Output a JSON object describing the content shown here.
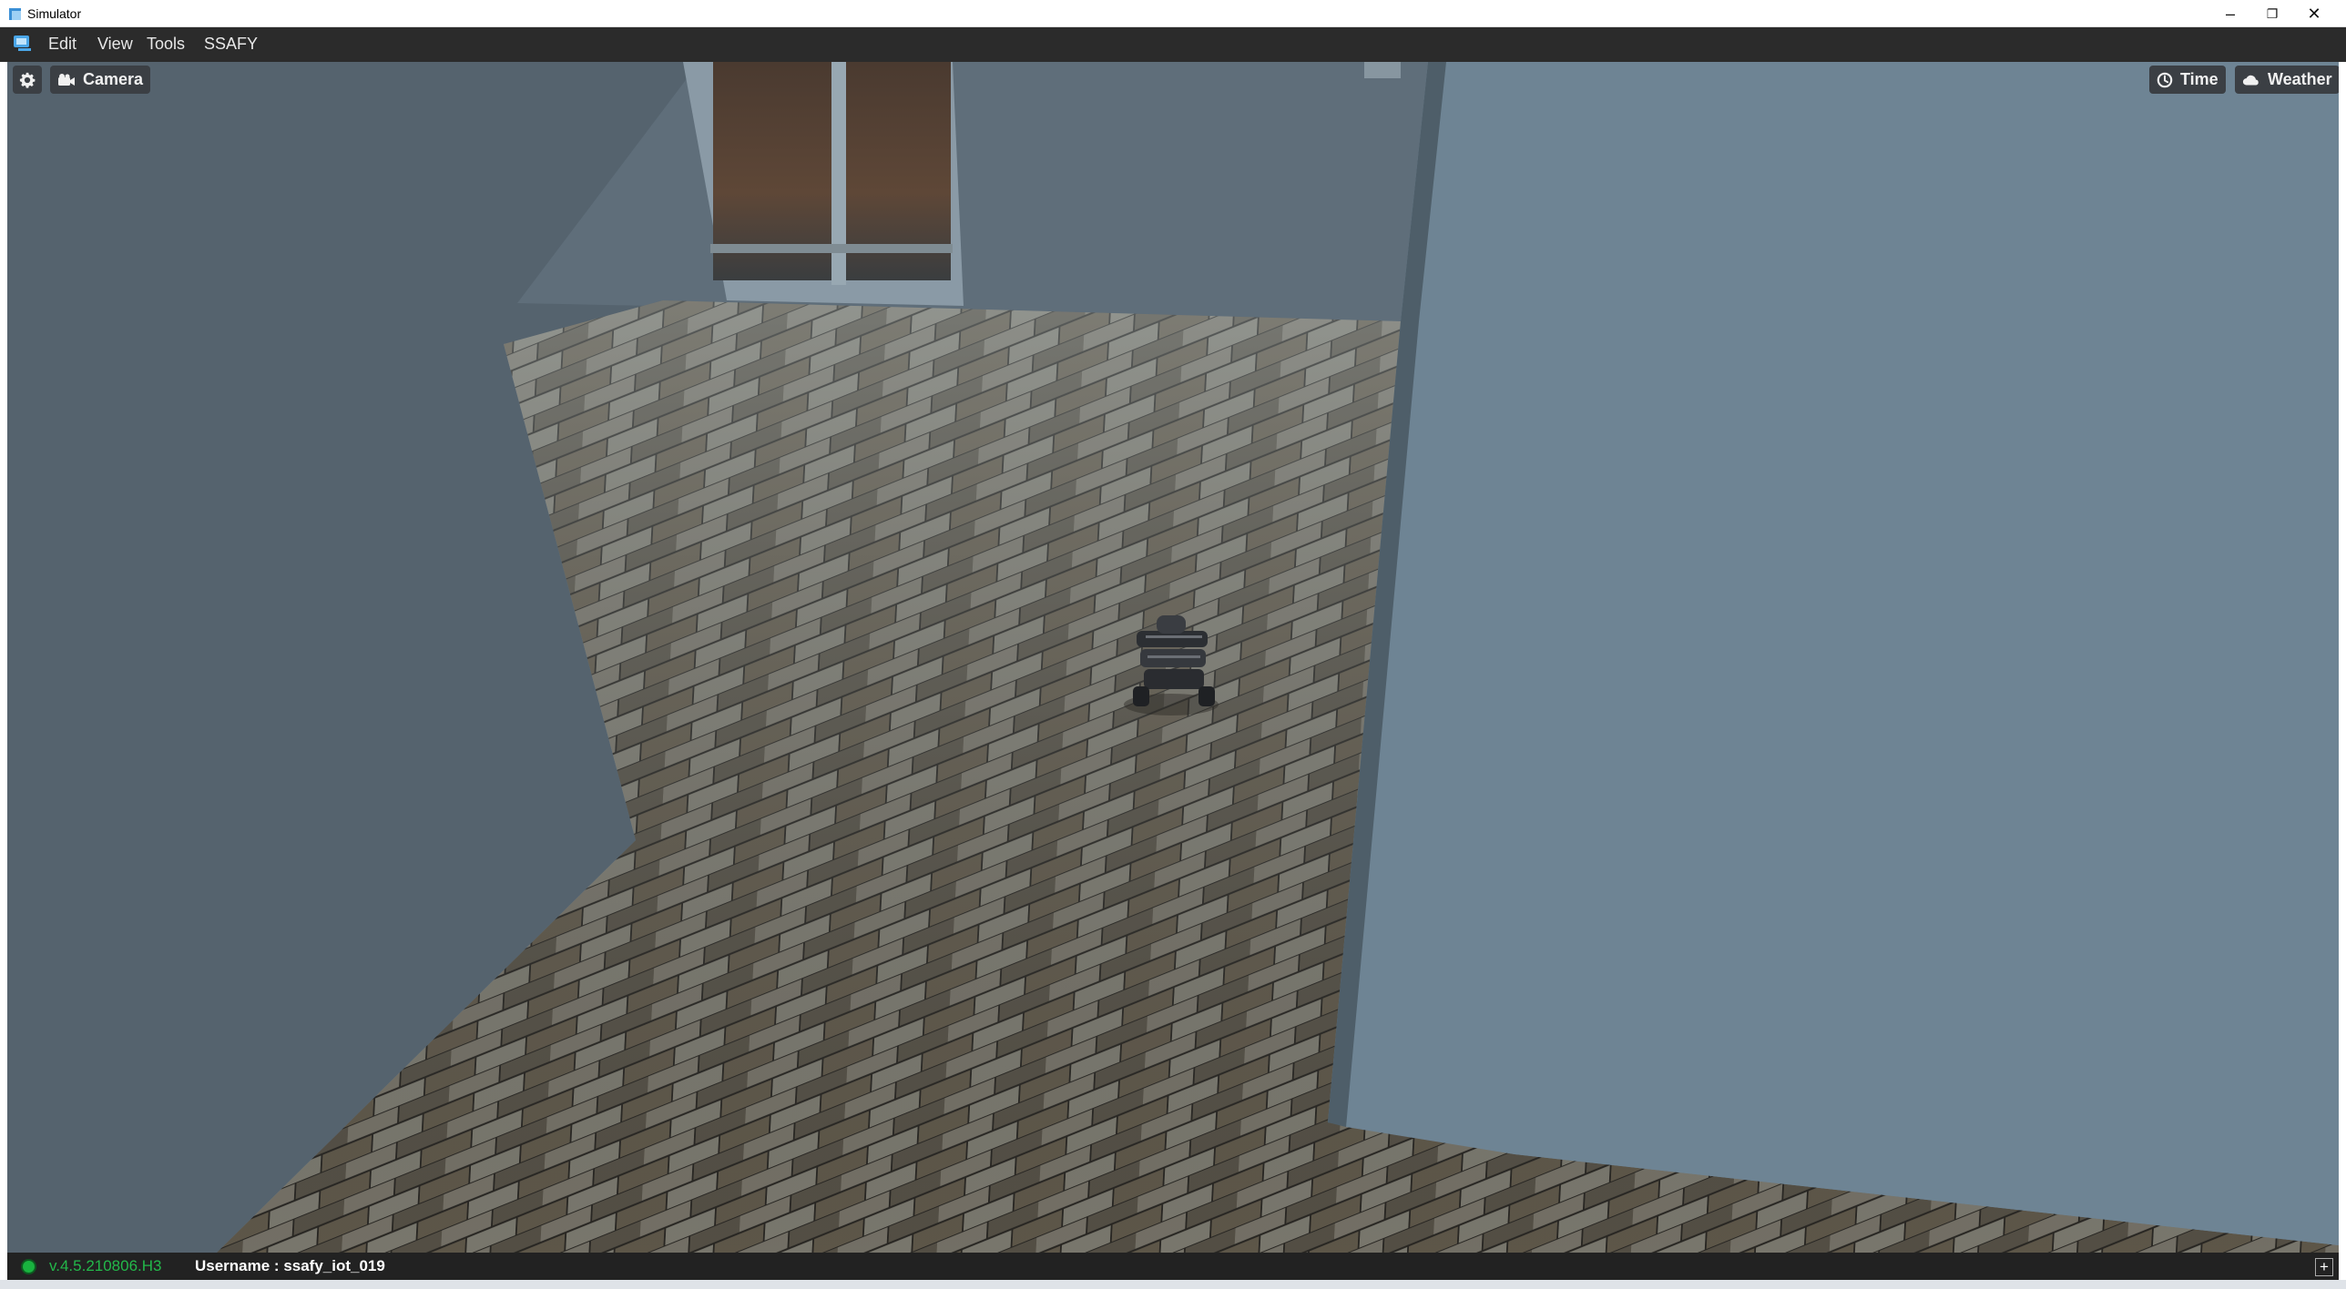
{
  "window": {
    "title": "Simulator",
    "minimize_glyph": "–",
    "restore_glyph": "❐",
    "close_glyph": "✕"
  },
  "menubar": {
    "logo": "simulator-logo-icon",
    "items": [
      "Edit",
      "View",
      "Tools",
      "SSAFY"
    ]
  },
  "toolbar": {
    "settings_icon": "gear-icon",
    "camera_label": "Camera",
    "time_label": "Time",
    "weather_label": "Weather"
  },
  "status": {
    "version": "v.4.5.210806.H3",
    "username_label": "Username : ssafy_iot_019",
    "add_glyph": "+"
  },
  "colors": {
    "menubar_bg": "#2b2b2b",
    "status_green": "#23b84a",
    "overlay_button_bg": "#3b3f44"
  }
}
